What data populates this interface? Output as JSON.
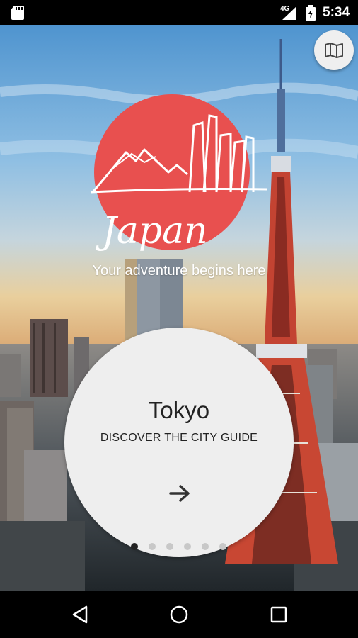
{
  "status_bar": {
    "network_label": "4G",
    "time": "5:34",
    "icons": [
      "sd-card-icon",
      "signal-icon",
      "battery-icon"
    ]
  },
  "hero": {
    "logo_text": "Japan",
    "tagline": "Your adventure begins here",
    "map_button_icon": "map-icon",
    "logo_color": "#e8504f"
  },
  "card": {
    "title": "Tokyo",
    "subtitle": "DISCOVER THE CITY GUIDE",
    "arrow_icon": "arrow-right-icon"
  },
  "pager": {
    "count": 6,
    "active_index": 0
  },
  "nav_bar": {
    "buttons": [
      "back-icon",
      "home-icon",
      "recents-icon"
    ]
  }
}
